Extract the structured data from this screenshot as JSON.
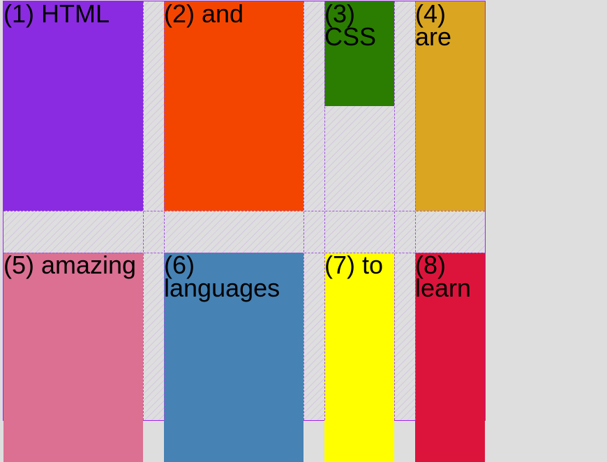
{
  "items": [
    {
      "label": "(1) HTML",
      "color": "#8a2be2"
    },
    {
      "label": "(2) and",
      "color": "#f44500"
    },
    {
      "label": "(3) CSS",
      "color": "#2a7d00"
    },
    {
      "label": "(4) are",
      "color": "#daa520"
    },
    {
      "label": "(5) amazing",
      "color": "#db7093"
    },
    {
      "label": "(6) languages",
      "color": "#4682b4"
    },
    {
      "label": "(7) to",
      "color": "#ffff00"
    },
    {
      "label": "(8) learn",
      "color": "#dc143c"
    }
  ]
}
